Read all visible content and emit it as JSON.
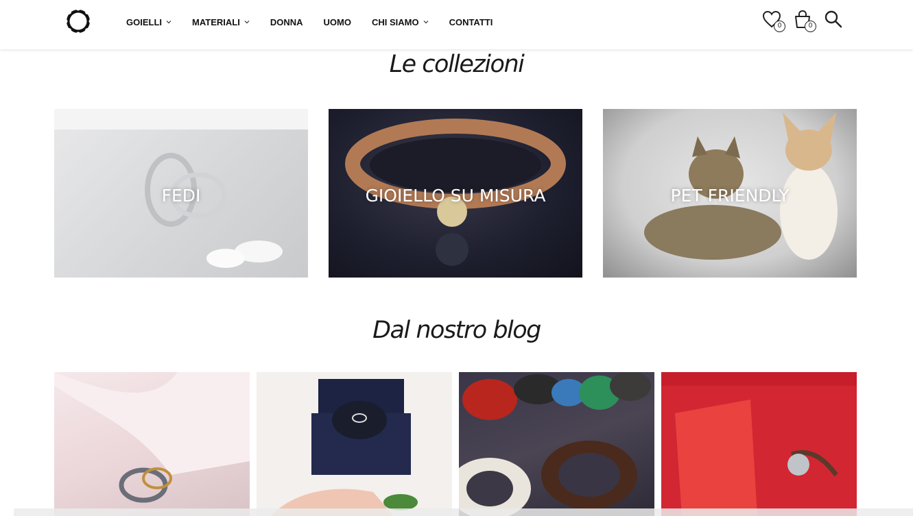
{
  "header": {
    "nav": [
      {
        "label": "GOIELLI",
        "dropdown": true
      },
      {
        "label": "MATERIALI",
        "dropdown": true
      },
      {
        "label": "DONNA",
        "dropdown": false
      },
      {
        "label": "UOMO",
        "dropdown": false
      },
      {
        "label": "CHI SIAMO",
        "dropdown": true
      },
      {
        "label": "CONTATTI",
        "dropdown": false
      }
    ],
    "wishlist_count": "0",
    "cart_count": "0",
    "icons": [
      "logo-ring-icon",
      "heart-icon",
      "shopping-bag-icon",
      "search-icon"
    ]
  },
  "collections": {
    "title": "Le collezioni",
    "items": [
      {
        "label": "FEDI"
      },
      {
        "label": "GIOIELLO SU MISURA"
      },
      {
        "label": "PET FRIENDLY"
      }
    ]
  },
  "blog": {
    "title": "Dal nostro blog",
    "item_count": 4
  }
}
